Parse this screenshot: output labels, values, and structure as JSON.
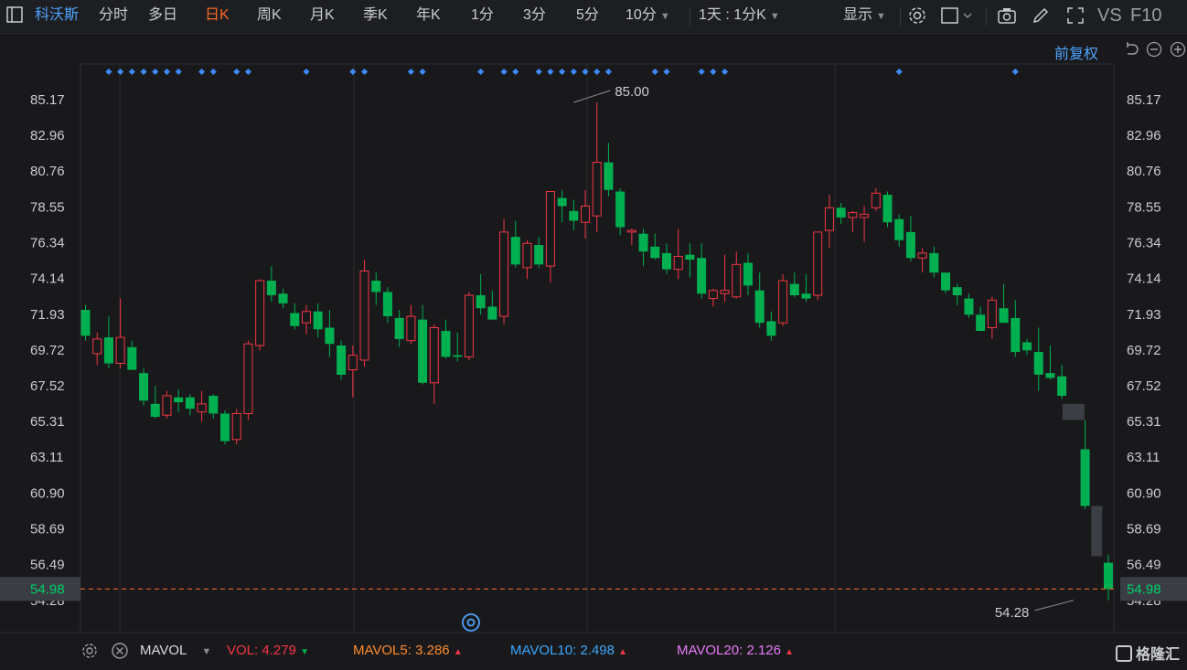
{
  "toolbar": {
    "stock_name": "科沃斯",
    "periods": [
      "分时",
      "多日",
      "日K",
      "周K",
      "月K",
      "季K",
      "年K",
      "1分",
      "3分",
      "5分",
      "10分"
    ],
    "active_period": "日K",
    "interval_select": "1天 : 1分K",
    "display_label": "显示",
    "vs_label": "VS",
    "f10_label": "F10"
  },
  "chart_header": {
    "adjust_label": "前复权"
  },
  "indicators": {
    "name": "MAVOL",
    "vol_label": "VOL:",
    "vol_value": "4.279",
    "mavol5_label": "MAVOL5:",
    "mavol5_value": "3.286",
    "mavol10_label": "MAVOL10:",
    "mavol10_value": "2.498",
    "mavol20_label": "MAVOL20:",
    "mavol20_value": "2.126"
  },
  "logo_text": "格隆汇",
  "colors": {
    "up": "#f23645",
    "down": "#00b050",
    "limit": "#3c3e45",
    "accent": "#ff6a24",
    "marker": "#3d8bff",
    "mavol5": "#ff8c2e",
    "mavol10": "#3aa7ff",
    "mavol20": "#e879f9"
  },
  "chart_data": {
    "type": "candlestick",
    "ylim": [
      53.5,
      86.2
    ],
    "y_ticks": [
      "85.17",
      "82.96",
      "80.76",
      "78.55",
      "76.34",
      "74.14",
      "71.93",
      "69.72",
      "67.52",
      "65.31",
      "63.11",
      "60.90",
      "58.69",
      "56.49",
      "54.28"
    ],
    "current_price": "54.98",
    "max_label": "85.00",
    "min_label": "54.28",
    "max_index": 42,
    "min_index": 85,
    "marker_indices": [
      2,
      3,
      4,
      5,
      6,
      7,
      8,
      10,
      11,
      13,
      14,
      19,
      23,
      24,
      28,
      29,
      34,
      36,
      37,
      39,
      40,
      41,
      42,
      43,
      44,
      45,
      49,
      50,
      53,
      54,
      55,
      70,
      80
    ],
    "candles": [
      [
        72.2,
        72.5,
        70.3,
        70.6
      ],
      [
        69.5,
        70.8,
        68.8,
        70.4
      ],
      [
        70.5,
        71.8,
        68.6,
        68.9
      ],
      [
        68.9,
        72.9,
        68.6,
        70.5
      ],
      [
        69.9,
        70.3,
        68.6,
        68.5
      ],
      [
        68.3,
        68.6,
        66.3,
        66.6
      ],
      [
        66.4,
        67.5,
        65.5,
        65.6
      ],
      [
        65.7,
        67.2,
        65.5,
        66.9
      ],
      [
        66.8,
        67.3,
        65.9,
        66.5
      ],
      [
        66.8,
        67.0,
        65.7,
        66.1
      ],
      [
        65.9,
        67.2,
        65.3,
        66.4
      ],
      [
        66.9,
        67.0,
        65.5,
        65.8
      ],
      [
        65.8,
        66.0,
        63.9,
        64.1
      ],
      [
        64.2,
        66.1,
        63.9,
        65.8
      ],
      [
        65.8,
        70.3,
        65.4,
        70.1
      ],
      [
        70.0,
        74.1,
        69.7,
        74.0
      ],
      [
        74.0,
        74.9,
        72.7,
        73.1
      ],
      [
        73.2,
        73.5,
        72.3,
        72.6
      ],
      [
        72.0,
        72.6,
        71.0,
        71.2
      ],
      [
        71.4,
        72.5,
        70.7,
        72.1
      ],
      [
        72.1,
        72.6,
        70.5,
        71.0
      ],
      [
        71.1,
        72.2,
        69.3,
        70.1
      ],
      [
        70.0,
        70.3,
        67.9,
        68.2
      ],
      [
        68.5,
        70.0,
        66.8,
        69.4
      ],
      [
        69.1,
        75.3,
        68.7,
        74.6
      ],
      [
        74.0,
        74.5,
        72.5,
        73.3
      ],
      [
        73.3,
        73.6,
        71.4,
        71.8
      ],
      [
        71.7,
        72.2,
        69.9,
        70.4
      ],
      [
        70.3,
        72.5,
        70.1,
        71.8
      ],
      [
        71.6,
        72.5,
        67.6,
        67.7
      ],
      [
        67.7,
        71.3,
        66.4,
        71.1
      ],
      [
        70.9,
        71.6,
        69.2,
        69.3
      ],
      [
        69.4,
        70.8,
        69.0,
        69.3
      ],
      [
        69.3,
        73.3,
        69.1,
        73.1
      ],
      [
        73.1,
        74.4,
        71.9,
        72.3
      ],
      [
        72.4,
        73.4,
        71.6,
        71.6
      ],
      [
        71.8,
        77.8,
        71.3,
        77.0
      ],
      [
        76.7,
        77.7,
        74.8,
        75.0
      ],
      [
        74.8,
        76.5,
        74.1,
        76.3
      ],
      [
        76.2,
        76.7,
        74.8,
        75.0
      ],
      [
        74.9,
        79.5,
        73.9,
        79.5
      ],
      [
        79.1,
        79.6,
        77.6,
        78.6
      ],
      [
        78.3,
        79.0,
        77.1,
        77.7
      ],
      [
        77.6,
        79.6,
        76.6,
        78.6
      ],
      [
        78.0,
        85.0,
        77.0,
        81.3
      ],
      [
        81.3,
        82.5,
        79.2,
        79.6
      ],
      [
        79.5,
        79.7,
        76.8,
        77.3
      ],
      [
        77.0,
        77.2,
        76.2,
        77.1
      ],
      [
        76.9,
        77.2,
        74.9,
        75.8
      ],
      [
        76.1,
        76.9,
        75.3,
        75.4
      ],
      [
        75.7,
        76.3,
        74.4,
        74.7
      ],
      [
        74.7,
        77.2,
        74.1,
        75.5
      ],
      [
        75.6,
        76.3,
        74.2,
        75.3
      ],
      [
        75.4,
        76.3,
        72.9,
        73.2
      ],
      [
        72.9,
        73.5,
        72.4,
        73.4
      ],
      [
        73.2,
        75.6,
        72.7,
        73.4
      ],
      [
        73.0,
        75.8,
        72.9,
        75.0
      ],
      [
        75.1,
        75.7,
        73.1,
        73.7
      ],
      [
        73.4,
        74.5,
        71.1,
        71.4
      ],
      [
        71.5,
        72.1,
        70.3,
        70.6
      ],
      [
        71.4,
        74.4,
        71.2,
        74.0
      ],
      [
        73.8,
        74.5,
        73.0,
        73.1
      ],
      [
        73.2,
        74.4,
        72.7,
        72.9
      ],
      [
        73.1,
        75.7,
        72.8,
        77.0
      ],
      [
        77.1,
        79.3,
        76.0,
        78.5
      ],
      [
        78.5,
        78.8,
        77.5,
        77.9
      ],
      [
        77.9,
        78.3,
        77.0,
        78.2
      ],
      [
        77.9,
        78.6,
        76.4,
        78.1
      ],
      [
        78.5,
        79.7,
        78.3,
        79.4
      ],
      [
        79.3,
        79.5,
        77.3,
        77.6
      ],
      [
        77.8,
        78.1,
        76.1,
        76.5
      ],
      [
        77.0,
        78.0,
        75.2,
        75.4
      ],
      [
        75.4,
        76.0,
        74.5,
        75.7
      ],
      [
        75.7,
        76.1,
        74.2,
        74.5
      ],
      [
        74.5,
        74.4,
        73.2,
        73.4
      ],
      [
        73.6,
        73.8,
        72.5,
        73.1
      ],
      [
        72.9,
        73.2,
        71.7,
        71.9
      ],
      [
        71.9,
        72.4,
        70.9,
        70.9
      ],
      [
        71.1,
        73.0,
        70.4,
        72.8
      ],
      [
        72.3,
        73.8,
        71.8,
        71.4
      ],
      [
        71.7,
        72.8,
        69.3,
        69.6
      ],
      [
        70.2,
        70.4,
        69.4,
        69.7
      ],
      [
        69.6,
        71.1,
        67.2,
        68.2
      ],
      [
        68.3,
        70.0,
        67.9,
        68.0
      ],
      [
        68.1,
        68.8,
        66.7,
        66.9
      ],
      [
        66.4,
        66.4,
        65.4,
        65.4
      ],
      [
        63.6,
        65.4,
        59.9,
        60.1
      ],
      [
        60.1,
        60.1,
        57.0,
        57.0
      ],
      [
        56.6,
        57.1,
        54.28,
        54.98
      ]
    ]
  }
}
